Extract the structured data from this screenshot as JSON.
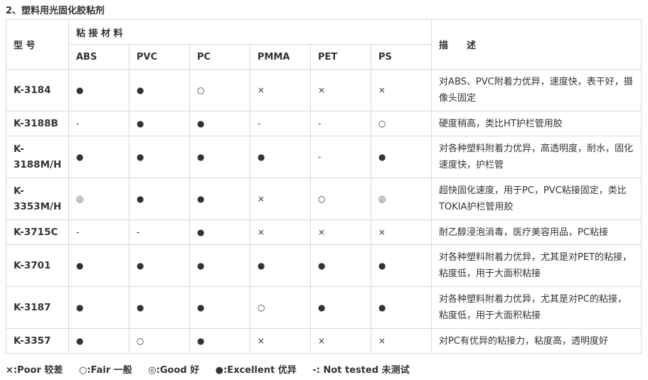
{
  "title": "2、塑料用光固化胶粘剂",
  "table": {
    "header_model": "型  号",
    "header_materials": "粘 接 材 料",
    "header_desc": "描　　述",
    "materials": [
      "ABS",
      "PVC",
      "PC",
      "PMMA",
      "PET",
      "PS"
    ],
    "rows": [
      {
        "model": "K-3184",
        "vals": [
          "●",
          "●",
          "○",
          "×",
          "×",
          "×"
        ],
        "desc": "对ABS、PVC附着力优异，速度快，表干好，摄像头固定"
      },
      {
        "model": "K-3188B",
        "vals": [
          "-",
          "●",
          "●",
          "-",
          "-",
          "○"
        ],
        "desc": "硬度稍高，类比HT护栏管用胶"
      },
      {
        "model": "K-3188M/H",
        "vals": [
          "●",
          "●",
          "●",
          "●",
          "-",
          "●"
        ],
        "desc": "对各种塑料附着力优异，高透明度，耐水，固化速度快，护栏管"
      },
      {
        "model": "K-3353M/H",
        "vals": [
          "◎",
          "●",
          "●",
          "×",
          "○",
          "◎"
        ],
        "desc": "超快固化速度，用于PC，PVC粘接固定，类比TOKIA护栏管用胶"
      },
      {
        "model": "K-3715C",
        "vals": [
          "-",
          "-",
          "●",
          "×",
          "×",
          "×"
        ],
        "desc": "耐乙醇浸泡消毒，医疗美容用品，PC粘接"
      },
      {
        "model": "K-3701",
        "vals": [
          "●",
          "●",
          "●",
          "●",
          "●",
          "●"
        ],
        "desc": "对各种塑料附着力优异，尤其是对PET的粘接，粘度低，用于大面积粘接"
      },
      {
        "model": "K-3187",
        "vals": [
          "●",
          "●",
          "●",
          "○",
          "●",
          "●"
        ],
        "desc": "对各种塑料附着力优异，尤其是对PC的粘接，粘度低，用于大面积粘接"
      },
      {
        "model": "K-3357",
        "vals": [
          "●",
          "○",
          "●",
          "×",
          "×",
          "×"
        ],
        "desc": "对PC有优异的粘接力，粘度高，透明度好"
      }
    ]
  },
  "legend": [
    "×:Poor 较差",
    "○:Fair 一般",
    "◎:Good 好",
    "●:Excellent 优异",
    "-: Not tested 未测试"
  ]
}
